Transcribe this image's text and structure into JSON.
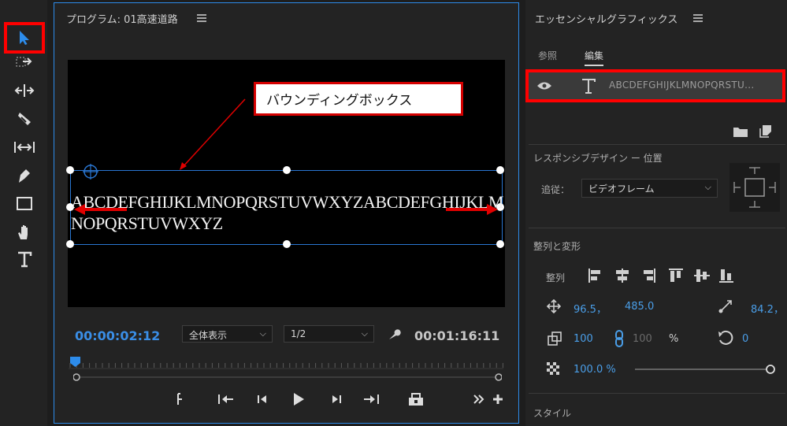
{
  "colors": {
    "accent_blue": "#2d8ceb",
    "highlight_red": "#ff0000",
    "value_blue": "#4a9ee8"
  },
  "tools": [
    {
      "name": "selection-tool",
      "icon": "arrow-icon",
      "selected": true
    },
    {
      "name": "track-select-tool",
      "icon": "track-select-icon"
    },
    {
      "name": "ripple-edit-tool",
      "icon": "ripple-edit-icon"
    },
    {
      "name": "razor-tool",
      "icon": "razor-icon"
    },
    {
      "name": "slip-tool",
      "icon": "slip-icon"
    },
    {
      "name": "pen-tool",
      "icon": "pen-icon"
    },
    {
      "name": "rectangle-tool",
      "icon": "rectangle-icon"
    },
    {
      "name": "hand-tool",
      "icon": "hand-icon"
    },
    {
      "name": "type-tool",
      "icon": "type-icon"
    }
  ],
  "program": {
    "title": "プログラム: 01高速道路",
    "callout": "バウンディングボックス",
    "sample_text": "ABCDEFGHIJKLMNOPQRSTUVWXYZABCDEFGHIJKLMNOPQRSTUVWXYZ",
    "current_timecode": "00:00:02:12",
    "zoom": "全体表示",
    "resolution": "1/2",
    "duration": "00:01:16:11"
  },
  "essential_graphics": {
    "title": "エッセンシャルグラフィックス",
    "tabs": {
      "browse": "参照",
      "edit": "編集"
    },
    "layer_name": "ABCDEFGHIJKLMNOPQRSTU...",
    "responsive_design": "レスポンシブデザイン ー 位置",
    "follow_label": "追従：",
    "follow_value": "ビデオフレーム",
    "align_transform": "整列と変形",
    "align_label": "整列",
    "pos_x": "96.5，",
    "pos_y": "485.0",
    "anchor_x": "84.2，",
    "scale": "100",
    "scale_height": "100",
    "percent": "%",
    "rotation": "0",
    "opacity": "100.0 %",
    "style": "スタイル"
  }
}
